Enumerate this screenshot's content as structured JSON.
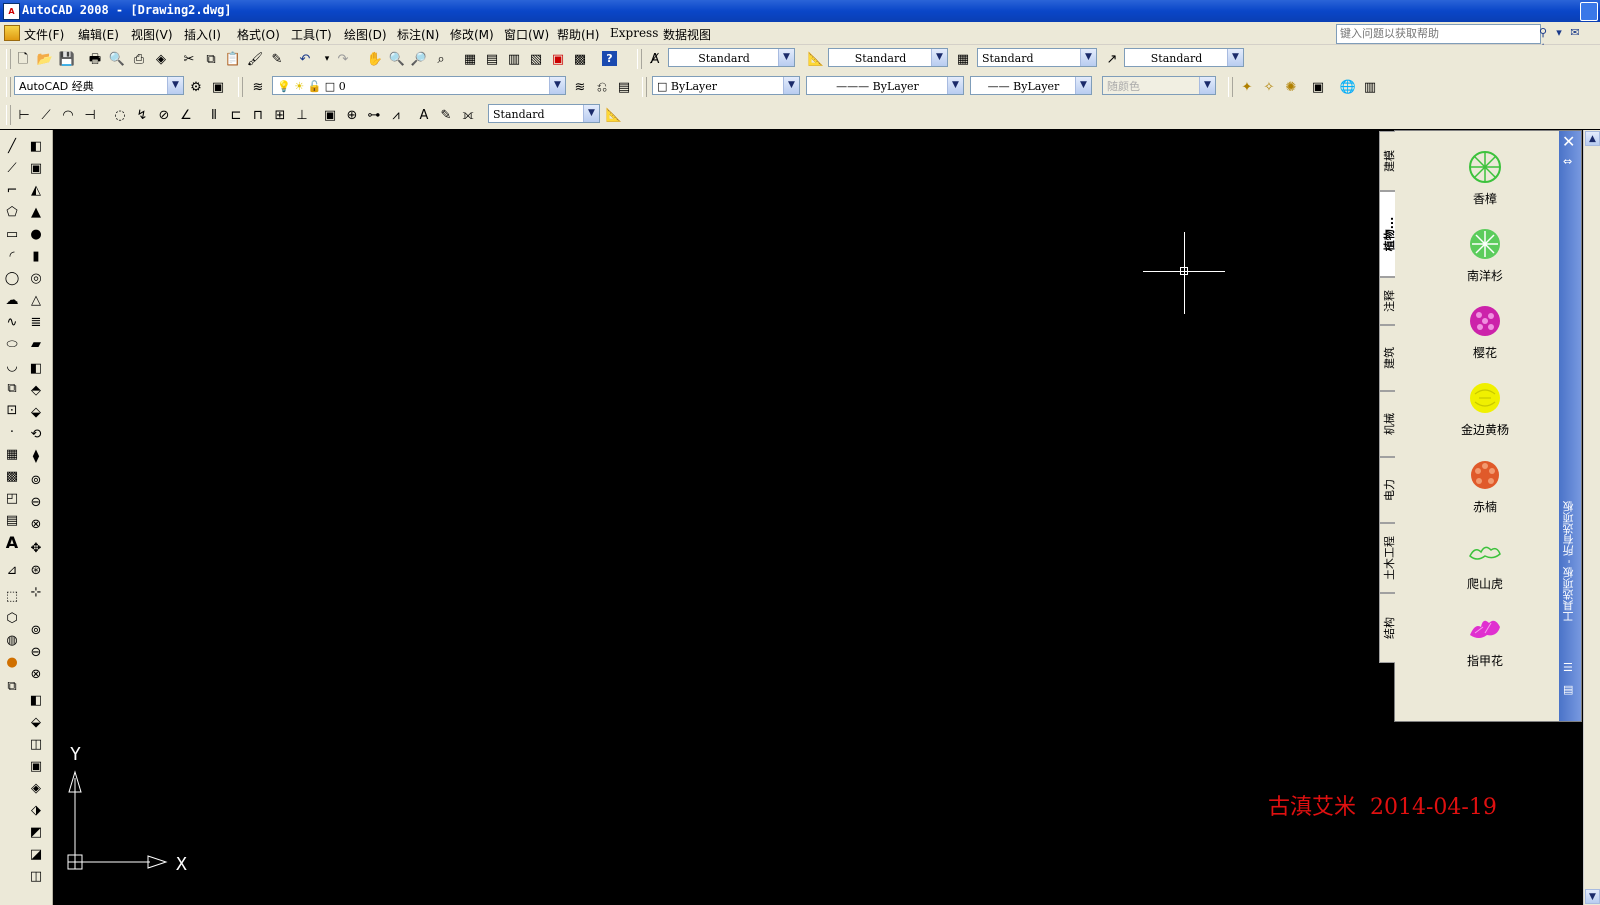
{
  "window": {
    "title": "AutoCAD 2008 - [Drawing2.dwg]"
  },
  "menubar": {
    "items": [
      "文件(F)",
      "编辑(E)",
      "视图(V)",
      "插入(I)",
      "格式(O)",
      "工具(T)",
      "绘图(D)",
      "标注(N)",
      "修改(M)",
      "窗口(W)",
      "帮助(H)",
      "Express",
      "数据视图"
    ]
  },
  "help": {
    "placeholder": "键入问题以获取帮助"
  },
  "styles_toolbar": {
    "text_style": "Standard",
    "dim_style": "Standard",
    "table_style": "Standard",
    "multileader_style": "Standard"
  },
  "workspace": {
    "value": "AutoCAD 经典"
  },
  "layers": {
    "current": "0"
  },
  "properties": {
    "color": "ByLayer",
    "linetype": "ByLayer",
    "lineweight": "ByLayer",
    "plotstyle": "随颜色"
  },
  "dim_toolbar": {
    "dim_style": "Standard"
  },
  "canvas": {
    "ucs_x": "X",
    "ucs_y": "Y",
    "stamp": "古滇艾米  2014-04-19",
    "stamp_color": "#e01010"
  },
  "tool_palette": {
    "title": "工具选项板 - 所有选项板",
    "tabs": [
      "建模",
      "植物...",
      "注释",
      "建筑",
      "机械",
      "电力",
      "土木工程",
      "结构"
    ],
    "active_tab": "植物...",
    "items": [
      {
        "label": "香樟",
        "icon": "tree-camphor-icon",
        "color": "#3cc23c"
      },
      {
        "label": "南洋杉",
        "icon": "tree-araucaria-icon",
        "color": "#4cc24c"
      },
      {
        "label": "樱花",
        "icon": "tree-cherry-icon",
        "color": "#cc22aa"
      },
      {
        "label": "金边黄杨",
        "icon": "shrub-boxwood-icon",
        "color": "#f0f000"
      },
      {
        "label": "赤楠",
        "icon": "shrub-syzygium-icon",
        "color": "#e05a2a"
      },
      {
        "label": "爬山虎",
        "icon": "vine-ivy-icon",
        "color": "#3cc23c"
      },
      {
        "label": "指甲花",
        "icon": "flower-impatiens-icon",
        "color": "#e030d0"
      }
    ]
  }
}
